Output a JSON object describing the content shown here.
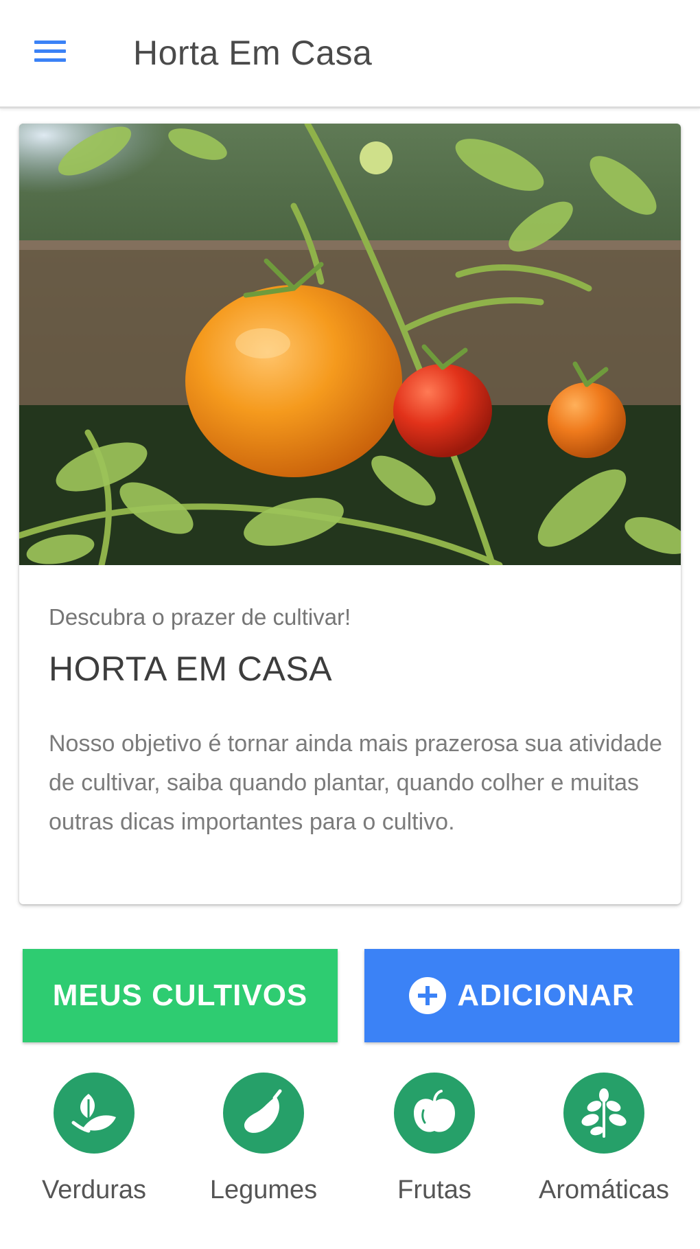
{
  "toolbar": {
    "title": "Horta Em Casa",
    "menu_icon": "hamburger-menu-icon",
    "accent_color": "#3b82f6"
  },
  "card": {
    "image": "tomato-plant-photo",
    "subtitle": "Descubra o prazer de cultivar!",
    "title": "HORTA EM CASA",
    "text": "Nosso objetivo é tornar ainda mais prazerosa sua atividade de cultivar, saiba quando plantar, quando colher e muitas outras dicas importantes para o cultivo."
  },
  "buttons": {
    "my_crops": {
      "label": "MEUS CULTIVOS",
      "color": "#2ecc71"
    },
    "add": {
      "label": "ADICIONAR",
      "icon": "add-circle-icon",
      "color": "#3b82f6"
    }
  },
  "categories": {
    "color": "#26a069",
    "items": [
      {
        "label": "Verduras",
        "icon": "leaf-icon"
      },
      {
        "label": "Legumes",
        "icon": "eggplant-icon"
      },
      {
        "label": "Frutas",
        "icon": "apple-icon"
      },
      {
        "label": "Aromáticas",
        "icon": "herb-icon"
      }
    ]
  }
}
